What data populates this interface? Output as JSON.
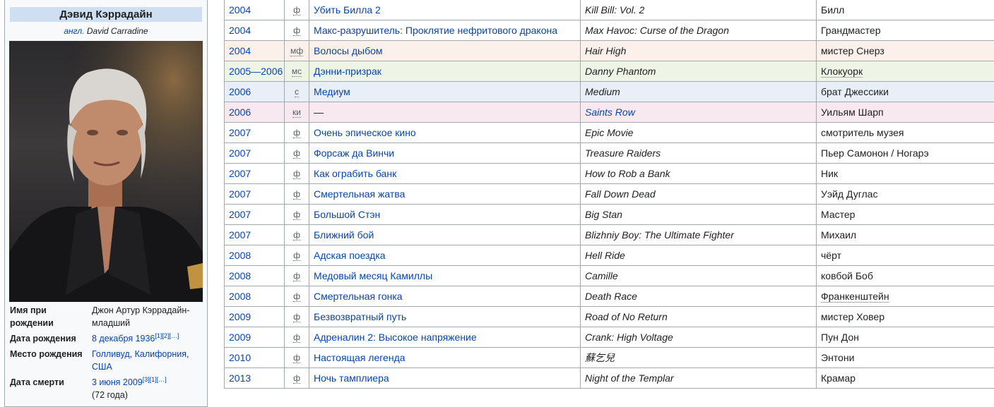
{
  "infobox": {
    "title": "Дэвид Кэррадайн",
    "subtitle_prefix": "англ.",
    "subtitle_original": "David Carradine",
    "rows": [
      {
        "label": "Имя при рождении",
        "value": "Джон Артур Кэррадайн-младший",
        "is_link": false,
        "sup": "",
        "extra": ""
      },
      {
        "label": "Дата рождения",
        "value": "8 декабря 1936",
        "is_link": true,
        "sup": "[1][2][…]",
        "extra": ""
      },
      {
        "label": "Место рождения",
        "value": "Голливуд, Калифорния, США",
        "is_link": true,
        "sup": "",
        "extra": ""
      },
      {
        "label": "Дата смерти",
        "value": "3 июня 2009",
        "is_link": true,
        "sup": "[3][1][…]",
        "extra": "(72 года)"
      }
    ]
  },
  "films": [
    {
      "year": "2004",
      "type": "ф",
      "title": "Убить Билла 2",
      "original": "Kill Bill: Vol. 2",
      "role": "Билл",
      "tone": "",
      "orig_link": false,
      "role_link": false
    },
    {
      "year": "2004",
      "type": "ф",
      "title": "Макс-разрушитель: Проклятие нефритового дракона",
      "original": "Max Havoc: Curse of the Dragon",
      "role": "Грандмастер",
      "tone": "",
      "orig_link": false,
      "role_link": false
    },
    {
      "year": "2004",
      "type": "мф",
      "title": "Волосы дыбом",
      "original": "Hair High",
      "role": "мистер Снерз",
      "tone": "mf",
      "orig_link": false,
      "role_link": false
    },
    {
      "year": "2005—2006",
      "type": "мс",
      "title": "Дэнни-призрак",
      "original": "Danny Phantom",
      "role": "Клокуорк",
      "tone": "ms",
      "orig_link": false,
      "role_link": true
    },
    {
      "year": "2006",
      "type": "с",
      "title": "Медиум",
      "original": "Medium",
      "role": "брат Джессики",
      "tone": "s",
      "orig_link": false,
      "role_link": false
    },
    {
      "year": "2006",
      "type": "ки",
      "title": "—",
      "original": "Saints Row",
      "role": "Уильям Шарп",
      "tone": "ki",
      "orig_link": true,
      "role_link": false
    },
    {
      "year": "2007",
      "type": "ф",
      "title": "Очень эпическое кино",
      "original": "Epic Movie",
      "role": "смотритель музея",
      "tone": "",
      "orig_link": false,
      "role_link": false
    },
    {
      "year": "2007",
      "type": "ф",
      "title": "Форсаж да Винчи",
      "original": "Treasure Raiders",
      "role": "Пьер Самонон / Ногарэ",
      "tone": "",
      "orig_link": false,
      "role_link": false
    },
    {
      "year": "2007",
      "type": "ф",
      "title": "Как ограбить банк",
      "original": "How to Rob a Bank",
      "role": "Ник",
      "tone": "",
      "orig_link": false,
      "role_link": false
    },
    {
      "year": "2007",
      "type": "ф",
      "title": "Смертельная жатва",
      "original": "Fall Down Dead",
      "role": "Уэйд Дуглас",
      "tone": "",
      "orig_link": false,
      "role_link": false
    },
    {
      "year": "2007",
      "type": "ф",
      "title": "Большой Стэн",
      "original": "Big Stan",
      "role": "Мастер",
      "tone": "",
      "orig_link": false,
      "role_link": false
    },
    {
      "year": "2007",
      "type": "ф",
      "title": "Ближний бой",
      "original": "Blizhniy Boy: The Ultimate Fighter",
      "role": "Михаил",
      "tone": "",
      "orig_link": false,
      "role_link": false
    },
    {
      "year": "2008",
      "type": "ф",
      "title": "Адская поездка",
      "original": "Hell Ride",
      "role": "чёрт",
      "tone": "",
      "orig_link": false,
      "role_link": false
    },
    {
      "year": "2008",
      "type": "ф",
      "title": "Медовый месяц Камиллы",
      "original": "Camille",
      "role": "ковбой Боб",
      "tone": "",
      "orig_link": false,
      "role_link": false
    },
    {
      "year": "2008",
      "type": "ф",
      "title": "Смертельная гонка",
      "original": "Death Race",
      "role": "Франкенштейн",
      "tone": "",
      "orig_link": false,
      "role_link": true
    },
    {
      "year": "2009",
      "type": "ф",
      "title": "Безвозвратный путь",
      "original": "Road of No Return",
      "role": "мистер Ховер",
      "tone": "",
      "orig_link": false,
      "role_link": false
    },
    {
      "year": "2009",
      "type": "ф",
      "title": "Адреналин 2: Высокое напряжение",
      "original": "Crank: High Voltage",
      "role": "Пун Дон",
      "tone": "",
      "orig_link": false,
      "role_link": false
    },
    {
      "year": "2010",
      "type": "ф",
      "title": "Настоящая легенда",
      "original": "蘇乞兒",
      "role": "Энтони",
      "tone": "",
      "orig_link": false,
      "role_link": false
    },
    {
      "year": "2013",
      "type": "ф",
      "title": "Ночь тамплиера",
      "original": "Night of the Templar",
      "role": "Крамар",
      "tone": "",
      "orig_link": false,
      "role_link": false
    }
  ]
}
